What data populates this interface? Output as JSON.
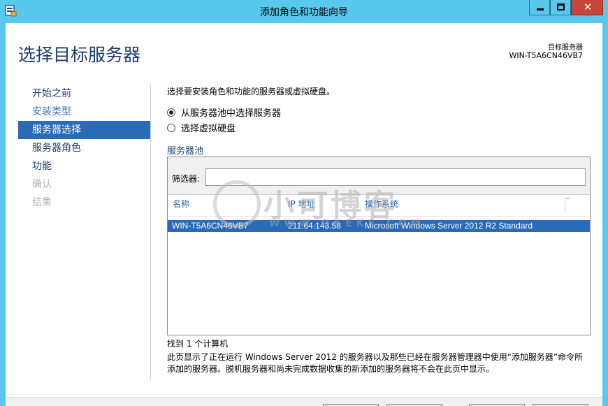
{
  "window": {
    "title": "添加角色和功能向导",
    "minimize_glyph": "",
    "maximize_glyph": "",
    "close_glyph": "✕"
  },
  "header": {
    "page_title": "选择目标服务器",
    "destination_label": "目标服务器",
    "destination_server": "WIN-T5A6CN46VB7"
  },
  "nav": {
    "items": [
      {
        "label": "开始之前",
        "state": "done"
      },
      {
        "label": "安装类型",
        "state": "link"
      },
      {
        "label": "服务器选择",
        "state": "active"
      },
      {
        "label": "服务器角色",
        "state": "done"
      },
      {
        "label": "功能",
        "state": "done"
      },
      {
        "label": "确认",
        "state": "disabled"
      },
      {
        "label": "结果",
        "state": "disabled"
      }
    ]
  },
  "main": {
    "intro": "选择要安装角色和功能的服务器或虚拟硬盘。",
    "options": [
      {
        "label": "从服务器池中选择服务器",
        "selected": true
      },
      {
        "label": "选择虚拟硬盘",
        "selected": false
      }
    ],
    "pool_title": "服务器池",
    "filter_label": "筛选器:",
    "filter_value": "",
    "columns": [
      "名称",
      "IP 地址",
      "操作系统"
    ],
    "rows": [
      [
        "WIN-T5A6CN46VB7",
        "211.64.143.58",
        "Microsoft Windows Server 2012 R2 Standard"
      ]
    ],
    "found_text": "找到 1 个计算机",
    "description": "此页显示了正在运行 Windows Server 2012 的服务器以及那些已经在服务器管理器中使用“添加服务器”命令所添加的服务器。脱机服务器和尚未完成数据收集的新添加的服务器将不会在此页中显示。"
  },
  "watermark": {
    "text": "小可博客",
    "sub": "WWW.QKEKE.COM"
  },
  "colors": {
    "titlebar": "#58c8ed",
    "accent": "#2a6bb8",
    "title_text": "#1e3c6e",
    "close": "#c7463a"
  }
}
